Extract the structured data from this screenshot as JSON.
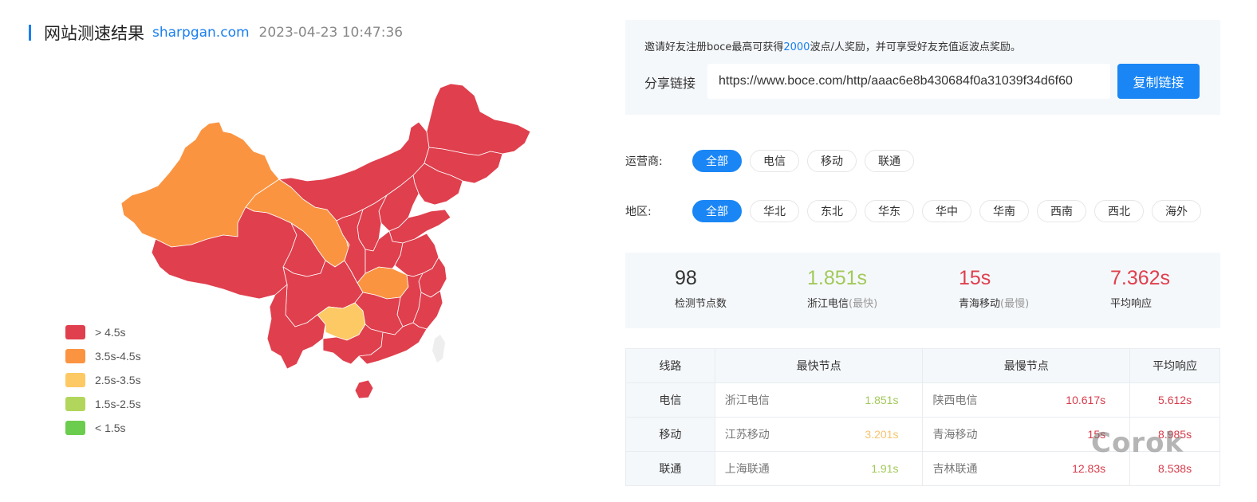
{
  "header": {
    "title": "网站测速结果",
    "site": "sharpgan.com",
    "time": "2023-04-23 10:47:36"
  },
  "legend": [
    {
      "label": "> 4.5s",
      "color": "#e03f4d"
    },
    {
      "label": "3.5s-4.5s",
      "color": "#fb9441"
    },
    {
      "label": "2.5s-3.5s",
      "color": "#fcc964"
    },
    {
      "label": "1.5s-2.5s",
      "color": "#b1d65b"
    },
    {
      "label": "< 1.5s",
      "color": "#6bcc4e"
    }
  ],
  "invite": {
    "text_pre": "邀请好友注册boce最高可获得",
    "text_highlight": "2000",
    "text_post": "波点/人奖励，并可享受好友充值返波点奖励。",
    "share_label": "分享链接",
    "share_url": "https://www.boce.com/http/aaac6e8b430684f0a31039f34d6f60",
    "copy_button": "复制链接"
  },
  "filters": {
    "operator": {
      "label": "运营商:",
      "options": [
        "全部",
        "电信",
        "移动",
        "联通"
      ],
      "active": "全部"
    },
    "region": {
      "label": "地区:",
      "options": [
        "全部",
        "华北",
        "东北",
        "华东",
        "华中",
        "华南",
        "西南",
        "西北",
        "海外"
      ],
      "active": "全部"
    }
  },
  "stats": {
    "nodes": {
      "value": "98",
      "label": "检测节点数",
      "color": "#333333"
    },
    "fastest": {
      "value": "1.851s",
      "label": "浙江电信",
      "suffix": "(最快)",
      "color": "#a2c95a"
    },
    "slowest": {
      "value": "15s",
      "label": "青海移动",
      "suffix": "(最慢)",
      "color": "#e03f4d"
    },
    "average": {
      "value": "7.362s",
      "label": "平均响应",
      "color": "#e03f4d"
    }
  },
  "table": {
    "headers": [
      "线路",
      "最快节点",
      "最慢节点",
      "平均响应"
    ],
    "rows": [
      {
        "line": "电信",
        "fast_name": "浙江电信",
        "fast_val": "1.851s",
        "fast_color": "#a2c95a",
        "slow_name": "陕西电信",
        "slow_val": "10.617s",
        "avg": "5.612s"
      },
      {
        "line": "移动",
        "fast_name": "江苏移动",
        "fast_val": "3.201s",
        "fast_color": "#f5c46e",
        "slow_name": "青海移动",
        "slow_val": "15s",
        "avg": "8.985s"
      },
      {
        "line": "联通",
        "fast_name": "上海联通",
        "fast_val": "1.91s",
        "fast_color": "#a2c95a",
        "slow_name": "吉林联通",
        "slow_val": "12.83s",
        "avg": "8.538s"
      }
    ]
  },
  "watermark": "Corok"
}
